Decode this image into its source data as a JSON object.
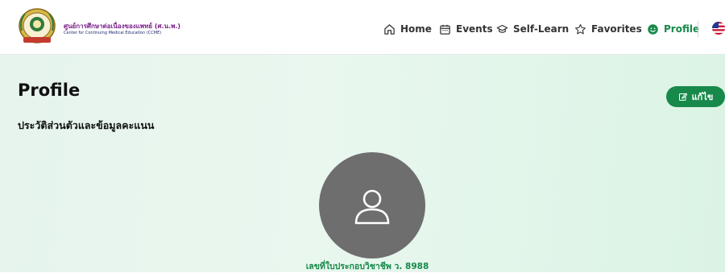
{
  "header": {
    "org_name_th": "ศูนย์การศึกษาต่อเนื่องของแพทย์ (ศ.น.พ.)",
    "org_name_en": "Center for Continuing Medical Education (CCME)",
    "nav": [
      {
        "label": "Home",
        "icon": "home-icon"
      },
      {
        "label": "Events",
        "icon": "calendar-icon"
      },
      {
        "label": "Self-Learn",
        "icon": "graduation-cap-icon"
      },
      {
        "label": "Favorites",
        "icon": "star-icon"
      },
      {
        "label": "Profile",
        "icon": "smiley-icon",
        "active": true
      }
    ],
    "language_flag": "us-flag-icon"
  },
  "page": {
    "title": "Profile",
    "subtitle": "ประวัติส่วนตัวและข้อมูลคะแนน",
    "edit_label": "แก้ไข",
    "license_text": "เลขที่ใบประกอบวิชาชีพ ว. 8988"
  },
  "colors": {
    "accent": "#17894a",
    "avatar_bg": "#6e6e6e"
  }
}
